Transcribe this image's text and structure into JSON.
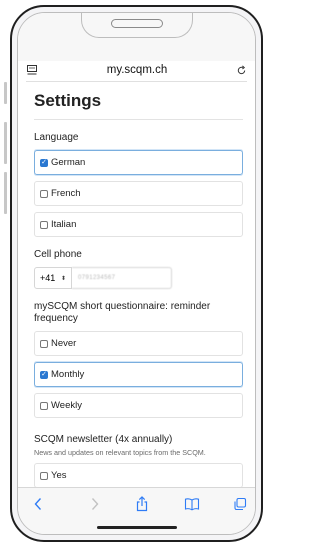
{
  "browser": {
    "url": "my.scqm.ch"
  },
  "page": {
    "title": "Settings"
  },
  "language": {
    "label": "Language",
    "options": [
      {
        "label": "German",
        "checked": true
      },
      {
        "label": "French",
        "checked": false
      },
      {
        "label": "Italian",
        "checked": false
      }
    ]
  },
  "cell_phone": {
    "label": "Cell phone",
    "prefix": "+41",
    "number": "0791234567"
  },
  "reminder": {
    "label": "mySCQM short questionnaire: reminder frequency",
    "options": [
      {
        "label": "Never",
        "checked": false
      },
      {
        "label": "Monthly",
        "checked": true
      },
      {
        "label": "Weekly",
        "checked": false
      }
    ]
  },
  "newsletter": {
    "label": "SCQM newsletter (4x annually)",
    "sublabel": "News and updates on relevant topics from the SCQM.",
    "options": [
      {
        "label": "Yes",
        "checked": false
      }
    ]
  },
  "colors": {
    "accent": "#2a78d1",
    "selected_border": "#7aaede",
    "toolbar_icon": "#2f7cf6"
  },
  "icons": [
    "reader-icon",
    "reload-icon",
    "back-icon",
    "forward-icon",
    "share-icon",
    "bookmarks-icon",
    "tabs-icon"
  ]
}
